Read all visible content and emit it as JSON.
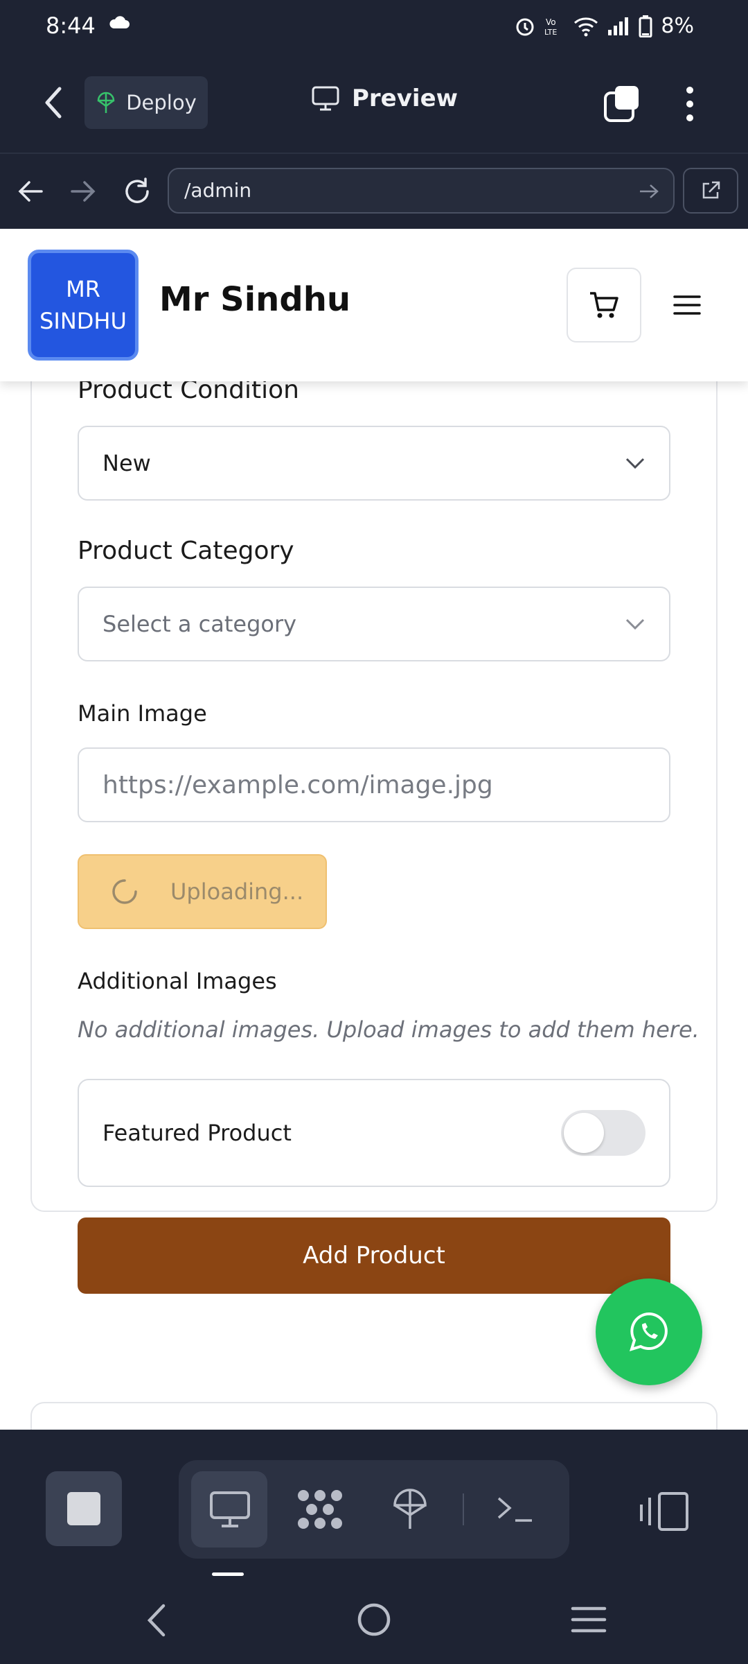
{
  "status_bar": {
    "time": "8:44",
    "battery": "8%"
  },
  "app_bar": {
    "deploy_label": "Deploy",
    "preview_label": "Preview"
  },
  "browser": {
    "url": "/admin"
  },
  "site": {
    "logo_line1": "MR",
    "logo_line2": "SINDHU",
    "brand": "Mr Sindhu"
  },
  "form": {
    "condition_label": "Product Condition",
    "condition_value": "New",
    "category_label": "Product Category",
    "category_placeholder": "Select a category",
    "main_image_label": "Main Image",
    "main_image_placeholder": "https://example.com/image.jpg",
    "upload_label": "Uploading...",
    "additional_label": "Additional Images",
    "additional_note": "No additional images. Upload images to add them here.",
    "featured_label": "Featured Product",
    "featured_on": false,
    "submit_label": "Add Product"
  },
  "colors": {
    "accent_brown": "#8b4513",
    "whatsapp_green": "#22c55e",
    "upload_bg": "#f7d08a",
    "logo_blue": "#2356e0"
  },
  "icons": {
    "status": [
      "cloud-icon",
      "alarm-icon",
      "volte-icon",
      "wifi-icon",
      "signal-icon",
      "battery-icon"
    ],
    "toolbar": [
      "stop-icon",
      "monitor-icon",
      "apps-icon",
      "deploy-icon",
      "terminal-icon",
      "devices-icon"
    ],
    "nav": [
      "back-icon",
      "home-icon",
      "recents-icon"
    ]
  }
}
